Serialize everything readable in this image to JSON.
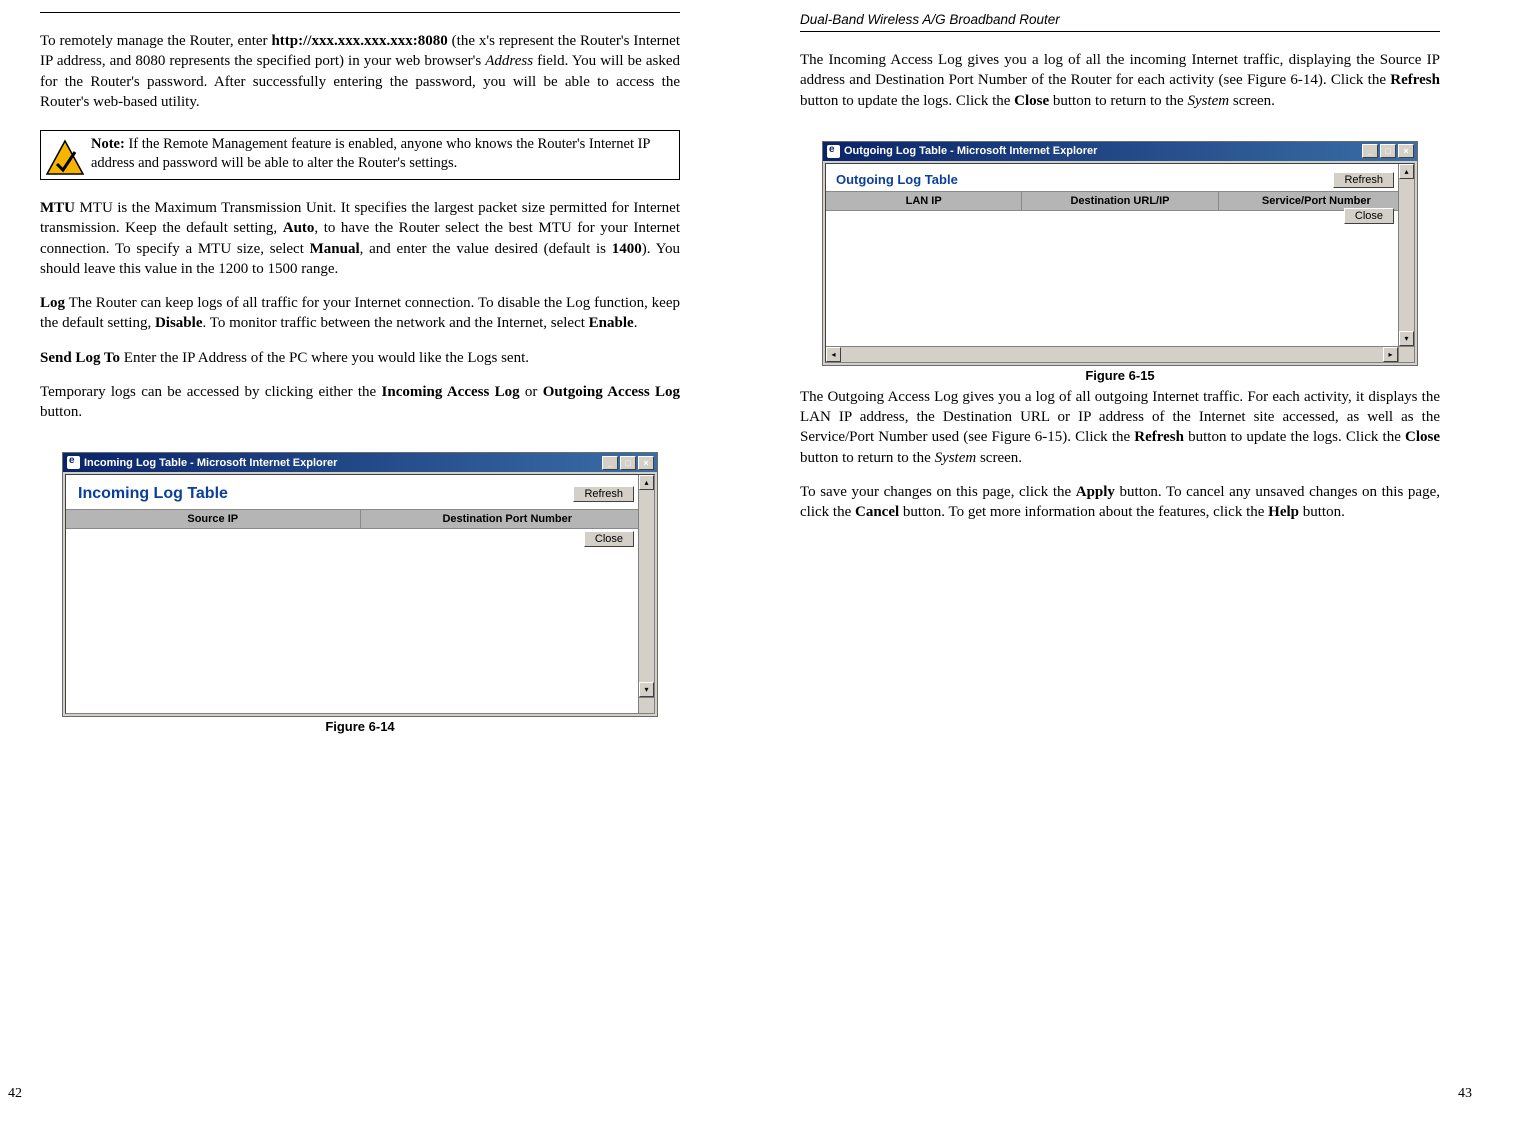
{
  "left": {
    "page_number": "42",
    "paras": {
      "p1_a": "To remotely manage the Router, enter ",
      "p1_b_bold": "http://xxx.xxx.xxx.xxx:8080",
      "p1_c": " (the x's represent the Router's Internet IP address, and 8080 represents the specified port) in your web browser's ",
      "p1_d_italic": "Address",
      "p1_e": " field. You will be asked for the Router's password. After successfully entering the password, you will be able to access the Router's web-based utility.",
      "note_label": "Note:",
      "note_body": " If the Remote Management feature is enabled, anyone who knows the Router's Internet IP address and password will be able to alter the Router's settings.",
      "p2_a_bold": "MTU",
      "p2_b": "  MTU is the Maximum Transmission Unit. It specifies the largest packet size permitted for Internet transmission. Keep the default setting, ",
      "p2_c_bold": "Auto",
      "p2_d": ", to have the Router select the best MTU for your Internet connection. To specify a MTU size, select ",
      "p2_e_bold": "Manual",
      "p2_f": ", and enter the value desired (default is ",
      "p2_g_bold": "1400",
      "p2_h": ").  You should leave this value in the 1200 to 1500 range.",
      "p3_a_bold": "Log",
      "p3_b": "  The Router can keep logs of all traffic for your Internet connection. To disable the Log function, keep the default setting, ",
      "p3_c_bold": "Disable",
      "p3_d": ". To monitor traffic between the network and the Internet, select ",
      "p3_e_bold": "Enable",
      "p3_f": ".",
      "p4_a_bold": "Send Log To",
      "p4_b": "  Enter the IP Address of the PC where you would like the Logs sent.",
      "p5_a": "Temporary logs can be accessed by clicking either the ",
      "p5_b_bold": "Incoming Access Log",
      "p5_c": " or ",
      "p5_d_bold": "Outgoing Access Log",
      "p5_e": " button."
    },
    "figure": {
      "caption": "Figure 6-14",
      "window_title": "Incoming Log Table - Microsoft Internet Explorer",
      "log_title": "Incoming Log Table",
      "col1": "Source IP",
      "col2": "Destination Port Number",
      "btn_refresh": "Refresh",
      "btn_close": "Close",
      "win_min": "_",
      "win_max": "□",
      "win_close": "×",
      "arrow_up": "▴",
      "arrow_down": "▾",
      "arrow_left": "◂",
      "arrow_right": "▸"
    }
  },
  "right": {
    "page_number": "43",
    "running_head": "Dual-Band Wireless A/G Broadband Router",
    "paras": {
      "p1_a": "The Incoming Access Log gives you a log of all the incoming Internet traffic, displaying the Source IP address and Destination Port Number of the Router for each activity (see Figure 6-14). Click the ",
      "p1_b_bold": "Refresh",
      "p1_c": " button to update the logs. Click the ",
      "p1_d_bold": "Close",
      "p1_e": " button to return to the ",
      "p1_f_italic": "System",
      "p1_g": " screen.",
      "p2_a": "The Outgoing Access Log gives you a log of all outgoing Internet traffic. For each activity, it displays the LAN IP address, the Destination URL or IP address of the Internet site accessed, as well as the Service/Port Number used (see Figure 6-15). Click the ",
      "p2_b_bold": "Refresh",
      "p2_c": " button to update the logs. Click the ",
      "p2_d_bold": "Close",
      "p2_e": " button to return to the ",
      "p2_f_italic": "System",
      "p2_g": " screen.",
      "p3_a": "To save your changes on this page, click the ",
      "p3_b_bold": "Apply",
      "p3_c": " button. To cancel any unsaved changes on this page, click the ",
      "p3_d_bold": "Cancel",
      "p3_e": " button. To get more information about the features, click the ",
      "p3_f_bold": "Help",
      "p3_g": " button."
    },
    "figure": {
      "caption": "Figure 6-15",
      "window_title": "Outgoing Log Table - Microsoft Internet Explorer",
      "log_title": "Outgoing Log Table",
      "col1": "LAN IP",
      "col2": "Destination URL/IP",
      "col3": "Service/Port Number",
      "btn_refresh": "Refresh",
      "btn_close": "Close",
      "win_min": "_",
      "win_max": "□",
      "win_close": "×",
      "arrow_up": "▴",
      "arrow_down": "▾",
      "arrow_left": "◂",
      "arrow_right": "▸"
    }
  }
}
